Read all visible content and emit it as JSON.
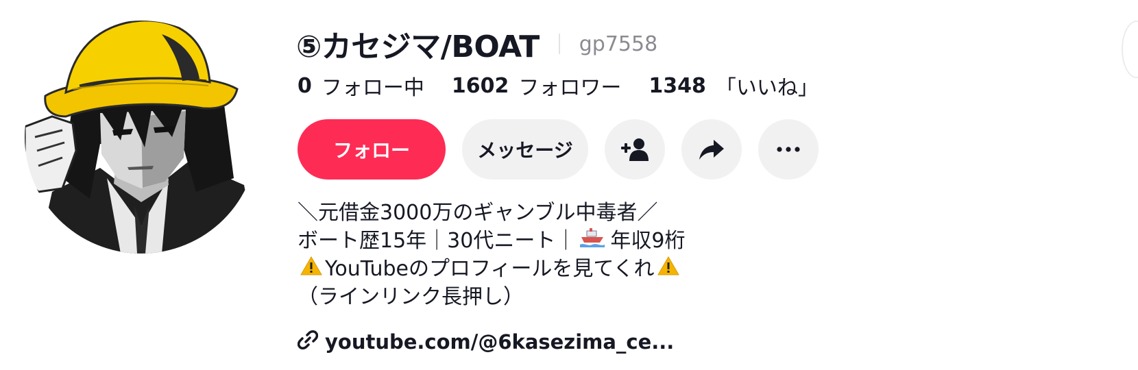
{
  "profile": {
    "display_name": "⑤カセジマ/BOAT",
    "username": "gp7558",
    "avatar_icon": "avatar-illustration"
  },
  "stats": [
    {
      "number": "0",
      "label": "フォロー中"
    },
    {
      "number": "1602",
      "label": "フォロワー"
    },
    {
      "number": "1348",
      "label": "「いいね」"
    }
  ],
  "actions": {
    "follow_label": "フォロー",
    "message_label": "メッセージ",
    "add_friend_icon": "person-add-icon",
    "share_icon": "share-icon",
    "more_icon": "more-icon"
  },
  "bio": {
    "line1": "＼元借金3000万のギャンブル中毒者／",
    "line2_text": "ボート歴15年｜30代ニート｜",
    "line2_tail": "年収9桁",
    "line3_text": "YouTubeのプロフィールを見てくれ",
    "line4": "（ラインリンク長押し）"
  },
  "link": {
    "text": "youtube.com/@6kasezima_ce..."
  },
  "colors": {
    "follow_button": "#fe2c55",
    "secondary_button": "#f1f1f2",
    "text_primary": "#161823",
    "text_secondary": "#8a8b91"
  }
}
